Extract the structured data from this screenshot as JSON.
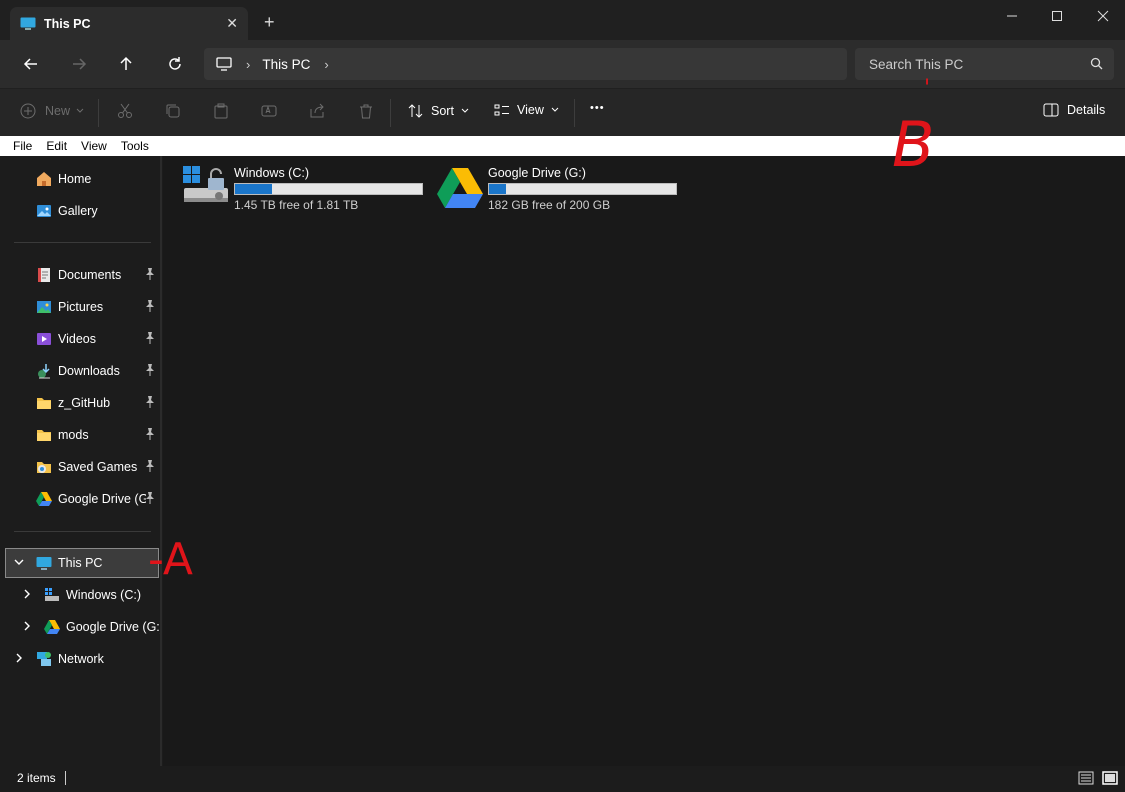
{
  "window": {
    "tab_title": "This PC",
    "close_tab_glyph": "✕",
    "new_tab_glyph": "+",
    "minimize_glyph": "—",
    "maximize_glyph": "☐",
    "close_glyph": "✕"
  },
  "address": {
    "crumb": "This PC",
    "separator": "›"
  },
  "search": {
    "placeholder": "Search This PC"
  },
  "toolbar": {
    "new_label": "New",
    "sort_label": "Sort",
    "view_label": "View",
    "more_label": "•••",
    "details_label": "Details"
  },
  "menu": [
    "File",
    "Edit",
    "View",
    "Tools"
  ],
  "sidebar": {
    "quick": [
      {
        "label": "Home",
        "icon": "home-icon"
      },
      {
        "label": "Gallery",
        "icon": "gallery-icon"
      }
    ],
    "pinned": [
      {
        "label": "Documents",
        "icon": "documents-icon"
      },
      {
        "label": "Pictures",
        "icon": "pictures-icon"
      },
      {
        "label": "Videos",
        "icon": "videos-icon"
      },
      {
        "label": "Downloads",
        "icon": "downloads-icon"
      },
      {
        "label": "z_GitHub",
        "icon": "folder-icon"
      },
      {
        "label": "mods",
        "icon": "folder-icon"
      },
      {
        "label": "Saved Games",
        "icon": "saved-games-icon"
      },
      {
        "label": "Google Drive (G:)",
        "icon": "google-drive-icon"
      }
    ],
    "tree": [
      {
        "label": "This PC",
        "icon": "this-pc-icon"
      },
      {
        "label": "Windows (C:)",
        "icon": "windows-drive-icon"
      },
      {
        "label": "Google Drive (G:)",
        "icon": "google-drive-icon"
      },
      {
        "label": "Network",
        "icon": "network-icon"
      }
    ]
  },
  "drives": [
    {
      "name": "Windows (C:)",
      "free_text": "1.45 TB free of 1.81 TB",
      "used_fraction": 0.199,
      "icon": "windows-drive-icon"
    },
    {
      "name": "Google Drive (G:)",
      "free_text": "182 GB free of 200 GB",
      "used_fraction": 0.09,
      "icon": "google-drive-icon"
    }
  ],
  "status": {
    "item_count": "2 items"
  },
  "annotations": {
    "a": "-A",
    "b_tick": "'",
    "b": "B"
  },
  "colors": {
    "accent": "#1a75c9",
    "annotation": "#e0141a"
  }
}
